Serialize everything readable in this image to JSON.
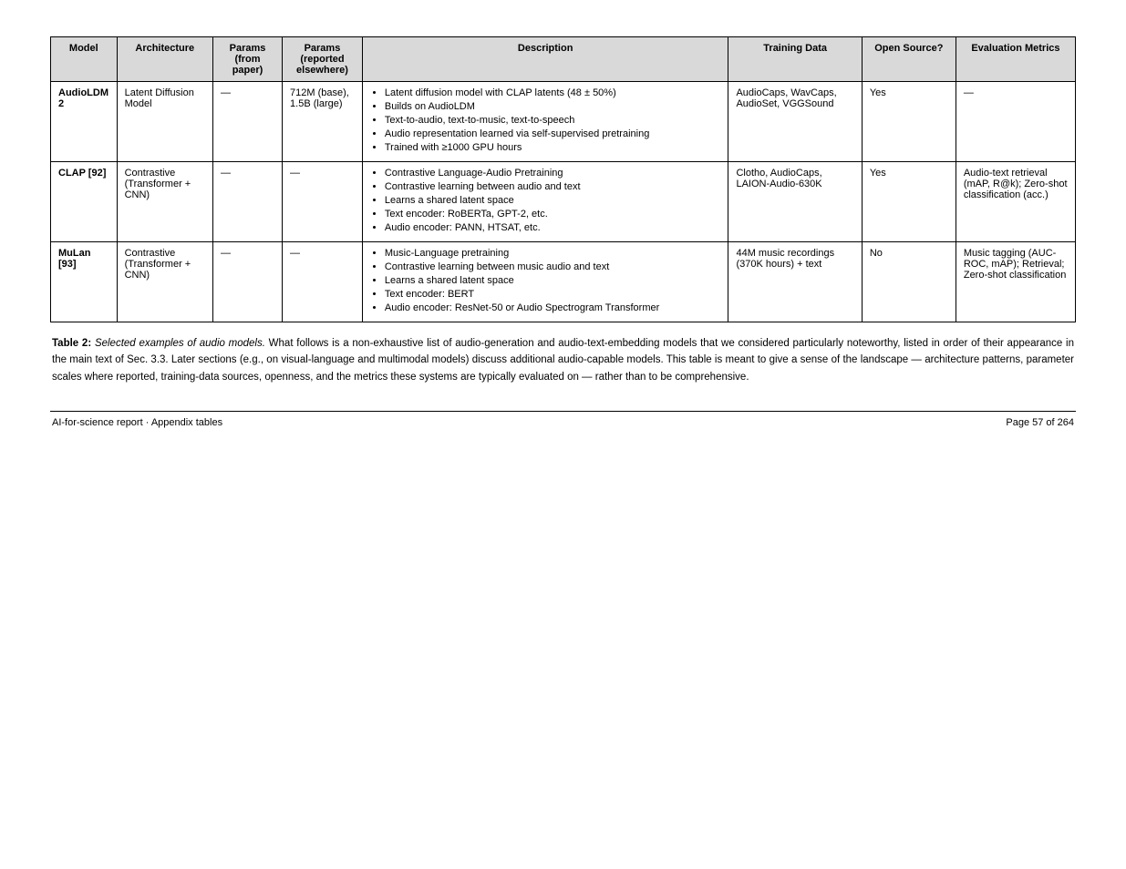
{
  "table": {
    "headers": [
      "Model",
      "Architecture",
      "Params (from paper)",
      "Params (reported elsewhere)",
      "Description",
      "Training Data",
      "Open Source?",
      "Evaluation Metrics"
    ],
    "rows": [
      {
        "model": "AudioLDM 2",
        "architecture": "Latent Diffusion Model",
        "params_paper": "—",
        "params_elsewhere": "712M (base), 1.5B (large)",
        "description_items": [
          "Latent diffusion model with CLAP latents (48 ± 50%)",
          "Builds on AudioLDM",
          "Text-to-audio, text-to-music, text-to-speech",
          "Audio representation learned via self-supervised pretraining",
          "Trained with ≥1000 GPU hours"
        ],
        "training_data": "AudioCaps, WavCaps, AudioSet, VGGSound",
        "open_source": "Yes",
        "evaluation": "—"
      },
      {
        "model": "CLAP [92]",
        "architecture": "Contrastive (Transformer + CNN)",
        "params_paper": "—",
        "params_elsewhere": "—",
        "description_items": [
          "Contrastive Language-Audio Pretraining",
          "Contrastive learning between audio and text",
          "Learns a shared latent space",
          "Text encoder: RoBERTa, GPT-2, etc.",
          "Audio encoder: PANN, HTSAT, etc."
        ],
        "training_data": "Clotho, AudioCaps, LAION-Audio-630K",
        "open_source": "Yes",
        "evaluation": "Audio-text retrieval (mAP, R@k); Zero-shot classification (acc.)"
      },
      {
        "model": "MuLan [93]",
        "architecture": "Contrastive (Transformer + CNN)",
        "params_paper": "—",
        "params_elsewhere": "—",
        "description_items": [
          "Music-Language pretraining",
          "Contrastive learning between music audio and text",
          "Learns a shared latent space",
          "Text encoder: BERT",
          "Audio encoder: ResNet-50 or Audio Spectrogram Transformer"
        ],
        "training_data": "44M music recordings (370K hours) + text",
        "open_source": "No",
        "evaluation": "Music tagging (AUC-ROC, mAP); Retrieval; Zero-shot classification"
      }
    ]
  },
  "caption": {
    "label": "Table 2:",
    "text_before_italic": " ",
    "italic": "Selected examples of audio models.",
    "text_after_italic": " What follows is a non-exhaustive list of audio-generation and audio-text-embedding models that we considered particularly noteworthy, listed in order of their appearance in the main text of Sec. 3.3. Later sections (e.g., on visual-language and multimodal models) discuss additional audio-capable models. This table is meant to give a sense of the landscape — architecture patterns, parameter scales where reported, training-data sources, openness, and the metrics these systems are typically evaluated on — rather than to be comprehensive."
  },
  "footer": {
    "left": "AI-for-science report · Appendix tables",
    "right": "Page 57 of 264"
  }
}
